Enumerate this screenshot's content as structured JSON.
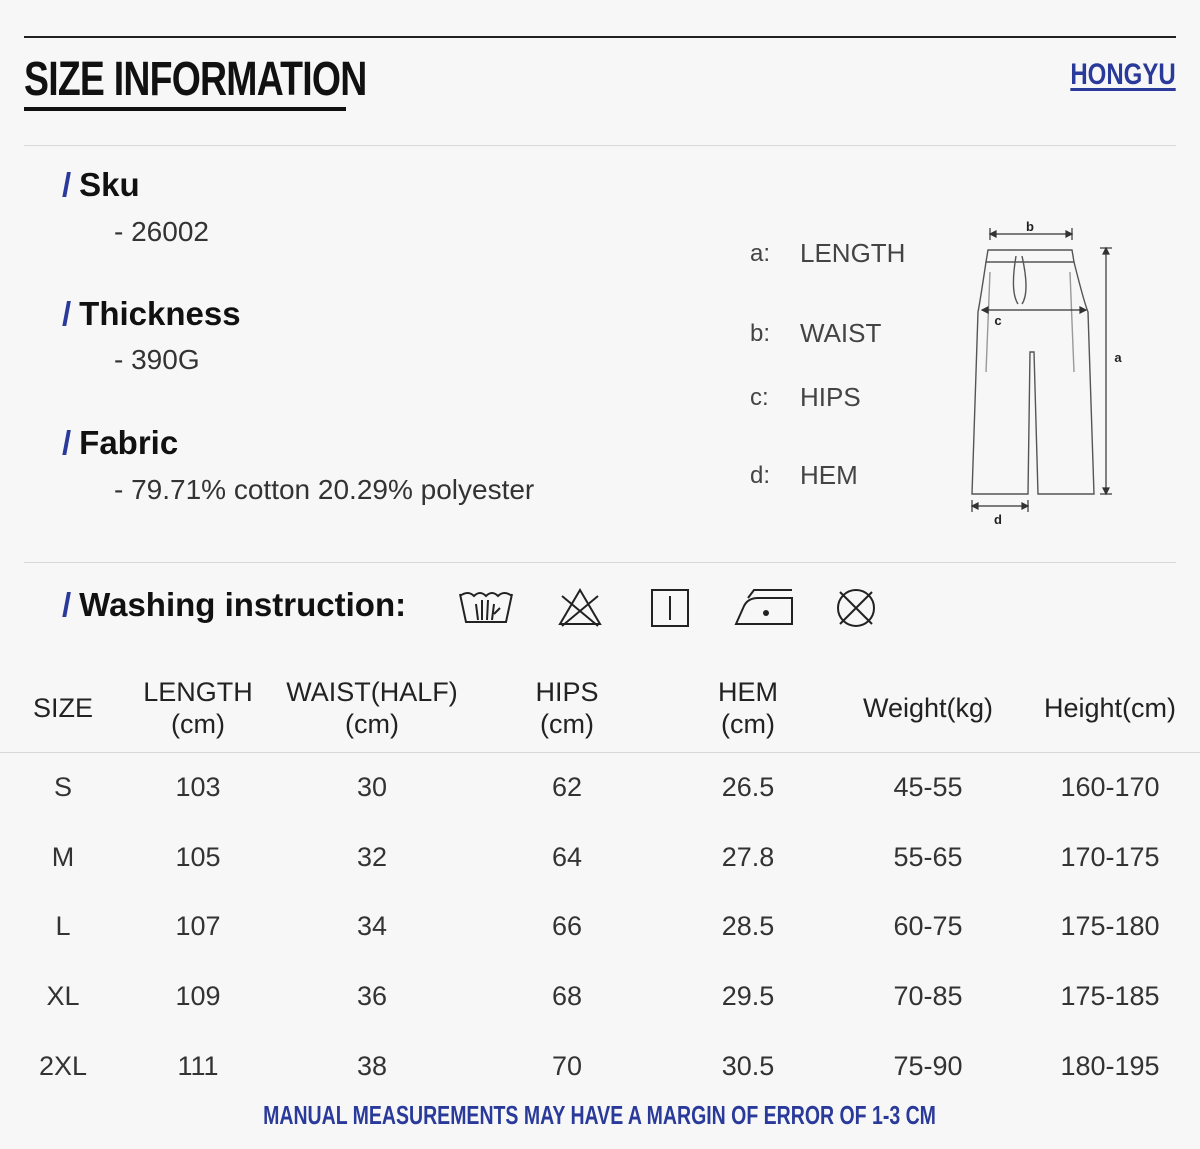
{
  "header": {
    "title": "SIZE INFORMATION",
    "brand": "HONGYU"
  },
  "details": {
    "sku_label": "Sku",
    "sku_value": "- 26002",
    "thickness_label": "Thickness",
    "thickness_value": "- 390G",
    "fabric_label": "Fabric",
    "fabric_value": "- 79.71% cotton 20.29% polyester",
    "slash": "/"
  },
  "legend": [
    {
      "key": "a:",
      "label": "LENGTH"
    },
    {
      "key": "b:",
      "label": "WAIST"
    },
    {
      "key": "c:",
      "label": "HIPS"
    },
    {
      "key": "d:",
      "label": "HEM"
    }
  ],
  "diagram_labels": {
    "a": "a",
    "b": "b",
    "c": "c",
    "d": "d"
  },
  "washing": {
    "label": "Washing instruction:",
    "icons": [
      "hand-wash-icon",
      "do-not-bleach-icon",
      "line-dry-icon",
      "iron-icon",
      "do-not-tumble-dry-icon"
    ]
  },
  "table": {
    "headers": [
      {
        "l1": "SIZE",
        "l2": ""
      },
      {
        "l1": "LENGTH",
        "l2": "(cm)"
      },
      {
        "l1": "WAIST(HALF)",
        "l2": "(cm)"
      },
      {
        "l1": "HIPS",
        "l2": "(cm)"
      },
      {
        "l1": "HEM",
        "l2": "(cm)"
      },
      {
        "l1": "Weight(kg)",
        "l2": ""
      },
      {
        "l1": "Height(cm)",
        "l2": ""
      }
    ],
    "rows": [
      [
        "S",
        "103",
        "30",
        "62",
        "26.5",
        "45-55",
        "160-170"
      ],
      [
        "M",
        "105",
        "32",
        "64",
        "27.8",
        "55-65",
        "170-175"
      ],
      [
        "L",
        "107",
        "34",
        "66",
        "28.5",
        "60-75",
        "175-180"
      ],
      [
        "XL",
        "109",
        "36",
        "68",
        "29.5",
        "70-85",
        "175-185"
      ],
      [
        "2XL",
        "111",
        "38",
        "70",
        "30.5",
        "75-90",
        "180-195"
      ]
    ]
  },
  "note": "MANUAL MEASUREMENTS MAY HAVE A MARGIN OF ERROR OF 1-3 CM",
  "colors": {
    "accent": "#2a3a9a",
    "text": "#222222",
    "background": "#f7f7f7"
  }
}
